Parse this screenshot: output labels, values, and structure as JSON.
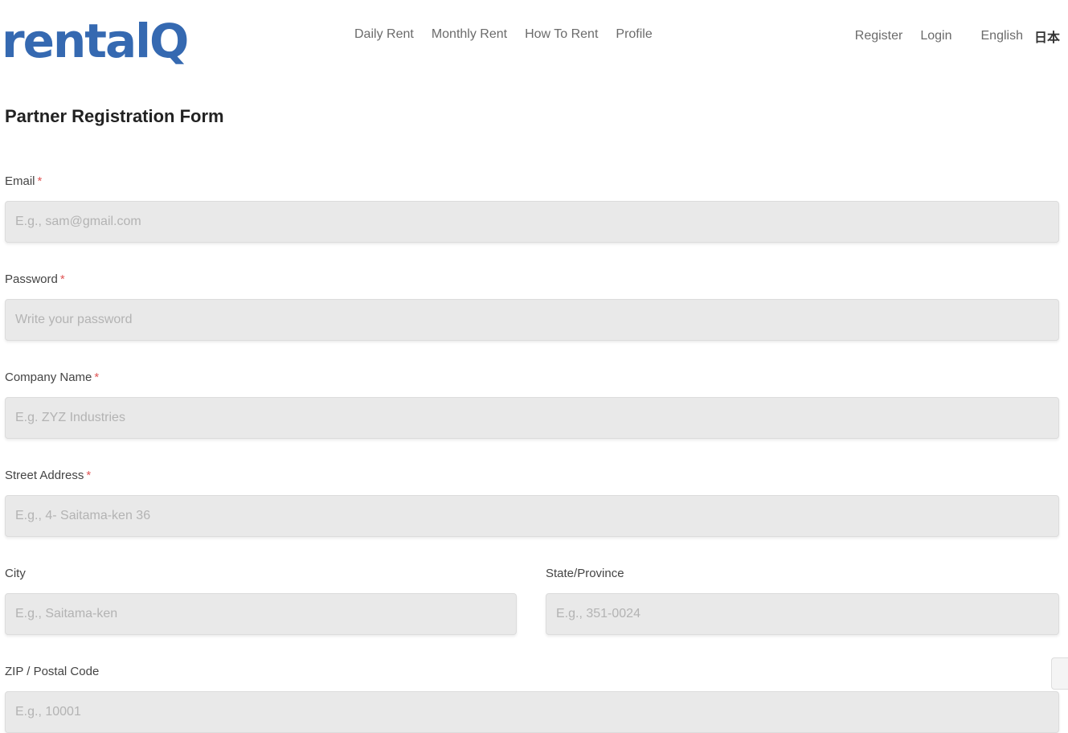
{
  "logo": {
    "text": "rentalQ"
  },
  "nav": {
    "main": [
      {
        "label": "Daily Rent"
      },
      {
        "label": "Monthly Rent"
      },
      {
        "label": "How To Rent"
      },
      {
        "label": "Profile"
      }
    ],
    "register": "Register",
    "login": "Login",
    "lang_en": "English",
    "lang_ja": "日本"
  },
  "form": {
    "title": "Partner Registration Form",
    "email": {
      "label": "Email",
      "required": "*",
      "placeholder": "E.g., sam@gmail.com"
    },
    "password": {
      "label": "Password",
      "required": "*",
      "placeholder": "Write your password"
    },
    "company": {
      "label": "Company Name",
      "required": "*",
      "placeholder": "E.g. ZYZ Industries"
    },
    "street": {
      "label": "Street Address",
      "required": "*",
      "placeholder": "E.g., 4- Saitama-ken 36"
    },
    "city": {
      "label": "City",
      "placeholder": "E.g., Saitama-ken"
    },
    "state": {
      "label": "State/Province",
      "placeholder": "E.g., 351-0024"
    },
    "zip": {
      "label": "ZIP / Postal Code",
      "placeholder": "E.g., 10001"
    }
  }
}
